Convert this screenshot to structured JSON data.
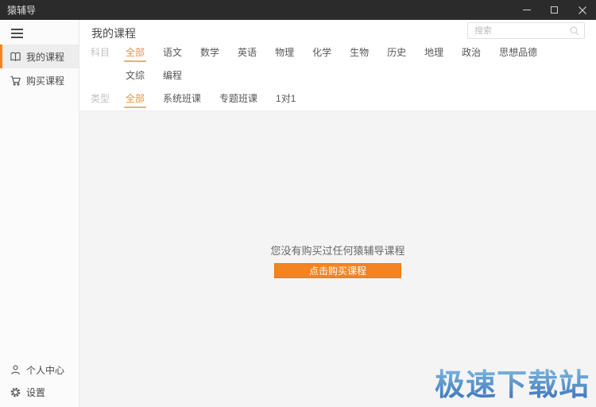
{
  "titlebar": {
    "app_title": "猿辅导",
    "controls": {
      "minimize": "minimize",
      "maximize": "maximize",
      "close": "close"
    }
  },
  "sidebar": {
    "items": [
      {
        "label": "我的课程",
        "icon": "book-icon",
        "active": true
      },
      {
        "label": "购买课程",
        "icon": "cart-icon",
        "active": false
      }
    ],
    "footer_items": [
      {
        "label": "个人中心",
        "icon": "person-icon"
      },
      {
        "label": "设置",
        "icon": "gear-icon"
      }
    ]
  },
  "header": {
    "title": "我的课程",
    "search_placeholder": "搜索"
  },
  "filters": {
    "subject_label": "科目",
    "subjects": [
      {
        "label": "全部",
        "active": true
      },
      {
        "label": "语文",
        "active": false
      },
      {
        "label": "数学",
        "active": false
      },
      {
        "label": "英语",
        "active": false
      },
      {
        "label": "物理",
        "active": false
      },
      {
        "label": "化学",
        "active": false
      },
      {
        "label": "生物",
        "active": false
      },
      {
        "label": "历史",
        "active": false
      },
      {
        "label": "地理",
        "active": false
      },
      {
        "label": "政治",
        "active": false
      },
      {
        "label": "思想品德",
        "active": false
      },
      {
        "label": "文综",
        "active": false
      },
      {
        "label": "编程",
        "active": false
      }
    ],
    "type_label": "类型",
    "types": [
      {
        "label": "全部",
        "active": true
      },
      {
        "label": "系统班课",
        "active": false
      },
      {
        "label": "专题班课",
        "active": false
      },
      {
        "label": "1对1",
        "active": false
      }
    ]
  },
  "empty_state": {
    "message": "您没有购买过任何猿辅导课程",
    "button_label": "点击购买课程"
  },
  "watermark": {
    "text": "极速下载站"
  },
  "colors": {
    "accent_orange": "#f78220",
    "button_orange": "#f5831f",
    "titlebar_dark": "#2b2b2b",
    "content_gray": "#f4f4f4",
    "watermark_blue_top": "#8ec4e2",
    "watermark_blue_bottom": "#3a70b8"
  }
}
